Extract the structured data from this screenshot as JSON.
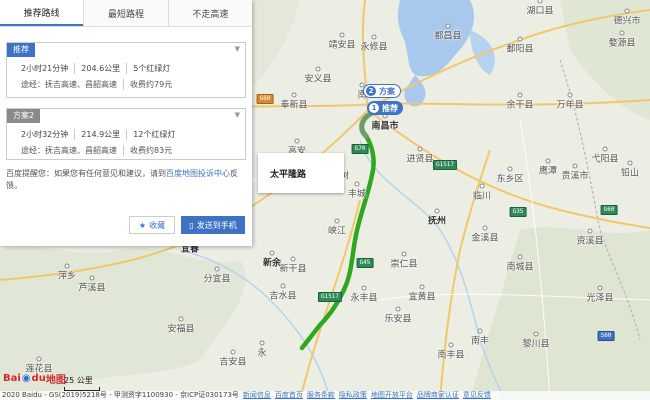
{
  "tabs": [
    "推荐路线",
    "最短路程",
    "不走高速"
  ],
  "plans": [
    {
      "tag": "推荐",
      "stats": [
        "2小时21分钟",
        "204.6公里",
        "5个红绿灯"
      ],
      "via": "途经：抚吉高速、昌韶高速",
      "toll": "收费约79元"
    },
    {
      "tag": "方案2",
      "stats": [
        "2小时32分钟",
        "214.9公里",
        "12个红绿灯"
      ],
      "via": "途经：抚吉高速、昌韶高速",
      "toll": "收费约83元"
    }
  ],
  "notice": {
    "before": "百度提醒您：如果您有任何意见和建议，请到",
    "link": "百度地图投诉中心",
    "after": "反馈。"
  },
  "buttons": {
    "favorite": "收藏",
    "send": "发送到手机"
  },
  "popup": {
    "road": "太平隆路"
  },
  "markers": {
    "plan2_num": "2",
    "plan2_label": "方案",
    "plan1_num": "1",
    "plan1_label": "推荐",
    "start": "起"
  },
  "map": {
    "places": [
      {
        "name": "靖安县"
      },
      {
        "name": "永修县"
      },
      {
        "name": "都昌县"
      },
      {
        "name": "湖口县"
      },
      {
        "name": "鄱阳县"
      },
      {
        "name": "德兴市"
      },
      {
        "name": "婺源县"
      },
      {
        "name": "安义县"
      },
      {
        "name": "奉新县"
      },
      {
        "name": "南昌市"
      },
      {
        "name": "南"
      },
      {
        "name": "余干县"
      },
      {
        "name": "万年县"
      },
      {
        "name": "高安"
      },
      {
        "name": "进贤县"
      },
      {
        "name": "东乡区"
      },
      {
        "name": "弋阳县"
      },
      {
        "name": "铅山"
      },
      {
        "name": "鹰潭"
      },
      {
        "name": "贵溪市"
      },
      {
        "name": "樟树"
      },
      {
        "name": "丰城"
      },
      {
        "name": "临川"
      },
      {
        "name": "金溪县"
      },
      {
        "name": "资溪县"
      },
      {
        "name": "抚州"
      },
      {
        "name": "峡江"
      },
      {
        "name": "新干县"
      },
      {
        "name": "崇仁县"
      },
      {
        "name": "南城县"
      },
      {
        "name": "萍乡"
      },
      {
        "name": "芦溪县"
      },
      {
        "name": "宜春"
      },
      {
        "name": "分宜县"
      },
      {
        "name": "新余"
      },
      {
        "name": "吉水县"
      },
      {
        "name": "永丰县"
      },
      {
        "name": "乐安县"
      },
      {
        "name": "宜黄县"
      },
      {
        "name": "黎川县"
      },
      {
        "name": "莲花县"
      },
      {
        "name": "安福县"
      },
      {
        "name": "吉安县"
      },
      {
        "name": "永"
      },
      {
        "name": "光泽县"
      },
      {
        "name": "南丰县"
      },
      {
        "name": "南丰"
      }
    ],
    "shields": [
      "G70",
      "G60",
      "G45",
      "G1517",
      "G35",
      "G60",
      "S60",
      "G1517"
    ]
  },
  "scale": "25 公里",
  "footer": {
    "copyright": "2020 Baidu - GS(2019)5218号 - 甲测资字1100930 - 京ICP证030173号",
    "links": [
      "新闻信息",
      "百度首页",
      "服务条款",
      "隐私政策",
      "地图开放平台",
      "品牌商家认证",
      "意见反馈"
    ]
  }
}
